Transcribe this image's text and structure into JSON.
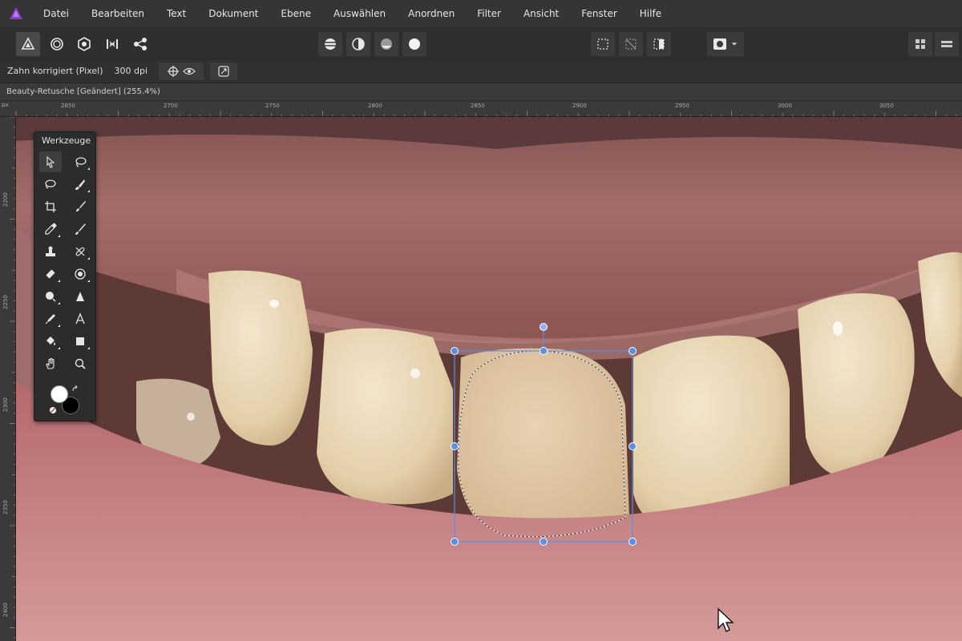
{
  "menubar": {
    "items": [
      "Datei",
      "Bearbeiten",
      "Text",
      "Dokument",
      "Ebene",
      "Auswählen",
      "Anordnen",
      "Filter",
      "Ansicht",
      "Fenster",
      "Hilfe"
    ]
  },
  "toolbar": {
    "persona_icons": [
      "photo-persona-icon",
      "liquify-persona-icon",
      "develop-persona-icon",
      "tone-mapping-persona-icon",
      "export-persona-icon"
    ],
    "adjust_icons": [
      "auto-levels-icon",
      "auto-contrast-icon",
      "auto-colors-icon",
      "auto-white-balance-icon"
    ],
    "selection_icons": [
      "selection-rectangle-icon",
      "selection-none-icon",
      "selection-invert-icon"
    ],
    "mask_icon": "quick-mask-icon",
    "view_icons": [
      "grid-view-icon",
      "panel-toggle-icon"
    ]
  },
  "contextbar": {
    "layer_name": "Zahn korrigiert (Pixel)",
    "resolution": "300 dpi"
  },
  "document": {
    "title": "Beauty-Retusche [Geändert] (255.4%)"
  },
  "rulers": {
    "unit": "px",
    "horizontal": [
      "2650",
      "2700",
      "2750",
      "2800",
      "2850",
      "2900",
      "2950",
      "3000",
      "3050"
    ],
    "vertical": [
      "2200",
      "2250",
      "2300",
      "2350",
      "2400"
    ]
  },
  "tools_panel": {
    "title": "Werkzeuge",
    "tools": [
      "move-tool-icon",
      "freehand-selection-tool-icon",
      "lasso-icon",
      "selection-brush-icon",
      "crop-tool-icon",
      "paint-brush-icon",
      "eyedropper-icon",
      "pixel-brush-icon",
      "clone-tool-icon",
      "healing-brush-icon",
      "eraser-icon",
      "dodge-tool-icon",
      "blur-tool-icon",
      "sharpen-tool-icon",
      "pen-tool-icon",
      "text-tool-icon",
      "fill-tool-icon",
      "shape-tool-icon",
      "hand-tool-icon",
      "zoom-tool-icon"
    ]
  },
  "colors": {
    "primary": "#ffffff",
    "secondary": "#000000",
    "selection_handle": "#5b8ee6"
  }
}
